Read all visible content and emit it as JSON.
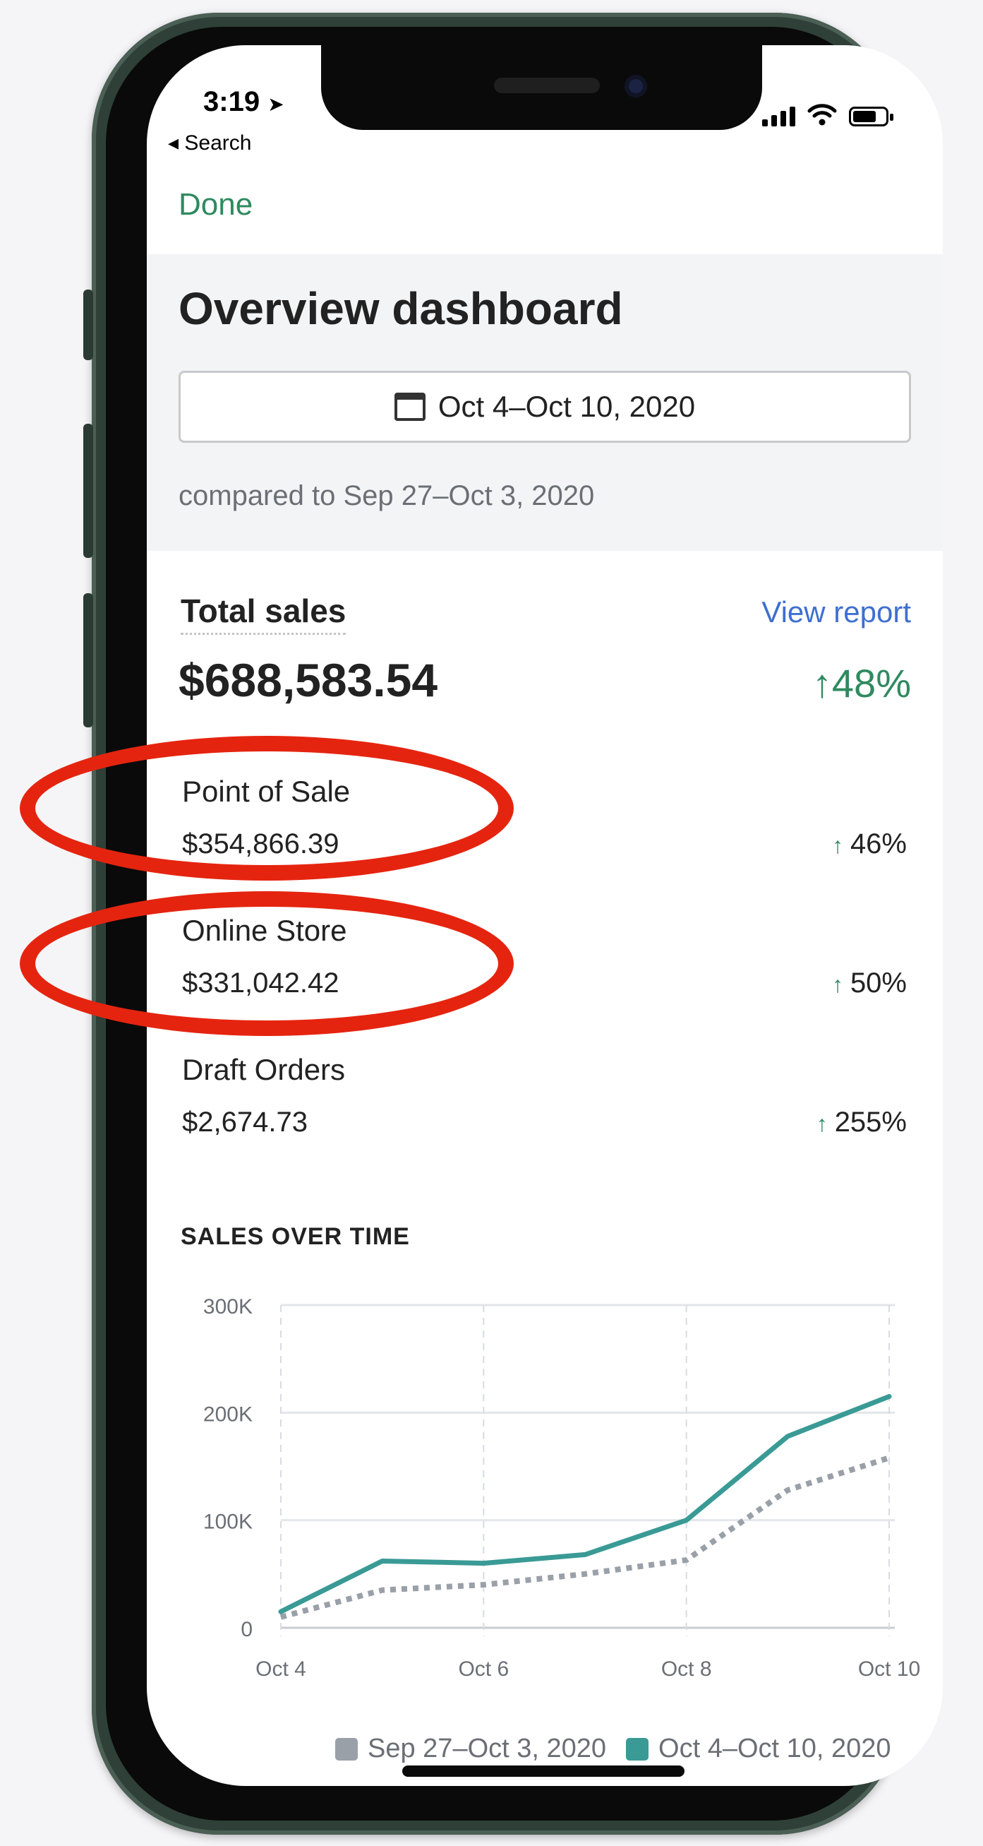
{
  "status_bar": {
    "time": "3:19",
    "location_glyph": "➤",
    "back_label": "◂ Search"
  },
  "nav": {
    "done_label": "Done"
  },
  "header": {
    "title": "Overview dashboard",
    "date_range": "Oct 4–Oct 10, 2020",
    "compared_to": "compared to Sep 27–Oct 3, 2020"
  },
  "total_sales": {
    "label": "Total sales",
    "view_report": "View report",
    "value": "$688,583.54",
    "change": "↑48%"
  },
  "channels": [
    {
      "label": "Point of Sale",
      "value": "$354,866.39",
      "change": "46%"
    },
    {
      "label": "Online Store",
      "value": "$331,042.42",
      "change": "50%"
    },
    {
      "label": "Draft Orders",
      "value": "$2,674.73",
      "change": "255%"
    }
  ],
  "chart_data": {
    "type": "line",
    "title": "SALES OVER TIME",
    "x": [
      "Oct 4",
      "Oct 5",
      "Oct 6",
      "Oct 7",
      "Oct 8",
      "Oct 9",
      "Oct 10"
    ],
    "x_tick_labels": [
      "Oct 4",
      "Oct 6",
      "Oct 8",
      "Oct 10"
    ],
    "y_tick_labels": [
      "300K",
      "200K",
      "100K",
      "0"
    ],
    "ylim": [
      0,
      300000
    ],
    "grid": true,
    "legend_position": "bottom",
    "series": [
      {
        "name": "Sep 27–Oct 3, 2020",
        "color": "#9aa0a8",
        "style": "dotted",
        "values": [
          10000,
          35000,
          40000,
          50000,
          63000,
          128000,
          158000
        ]
      },
      {
        "name": "Oct 4–Oct 10, 2020",
        "color": "#3a9a95",
        "style": "solid",
        "values": [
          15000,
          62000,
          60000,
          68000,
          100000,
          178000,
          215000
        ]
      }
    ]
  },
  "colors": {
    "accent_green": "#2f8a5f",
    "link_blue": "#3e6fd1",
    "annotation_red": "#e5240f"
  }
}
